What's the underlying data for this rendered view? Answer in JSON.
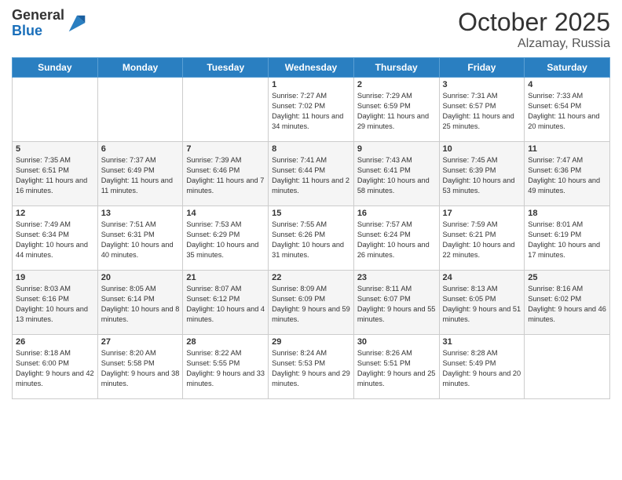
{
  "header": {
    "logo_general": "General",
    "logo_blue": "Blue",
    "month": "October 2025",
    "location": "Alzamay, Russia"
  },
  "days_of_week": [
    "Sunday",
    "Monday",
    "Tuesday",
    "Wednesday",
    "Thursday",
    "Friday",
    "Saturday"
  ],
  "weeks": [
    [
      {
        "day": "",
        "info": ""
      },
      {
        "day": "",
        "info": ""
      },
      {
        "day": "",
        "info": ""
      },
      {
        "day": "1",
        "info": "Sunrise: 7:27 AM\nSunset: 7:02 PM\nDaylight: 11 hours and 34 minutes."
      },
      {
        "day": "2",
        "info": "Sunrise: 7:29 AM\nSunset: 6:59 PM\nDaylight: 11 hours and 29 minutes."
      },
      {
        "day": "3",
        "info": "Sunrise: 7:31 AM\nSunset: 6:57 PM\nDaylight: 11 hours and 25 minutes."
      },
      {
        "day": "4",
        "info": "Sunrise: 7:33 AM\nSunset: 6:54 PM\nDaylight: 11 hours and 20 minutes."
      }
    ],
    [
      {
        "day": "5",
        "info": "Sunrise: 7:35 AM\nSunset: 6:51 PM\nDaylight: 11 hours and 16 minutes."
      },
      {
        "day": "6",
        "info": "Sunrise: 7:37 AM\nSunset: 6:49 PM\nDaylight: 11 hours and 11 minutes."
      },
      {
        "day": "7",
        "info": "Sunrise: 7:39 AM\nSunset: 6:46 PM\nDaylight: 11 hours and 7 minutes."
      },
      {
        "day": "8",
        "info": "Sunrise: 7:41 AM\nSunset: 6:44 PM\nDaylight: 11 hours and 2 minutes."
      },
      {
        "day": "9",
        "info": "Sunrise: 7:43 AM\nSunset: 6:41 PM\nDaylight: 10 hours and 58 minutes."
      },
      {
        "day": "10",
        "info": "Sunrise: 7:45 AM\nSunset: 6:39 PM\nDaylight: 10 hours and 53 minutes."
      },
      {
        "day": "11",
        "info": "Sunrise: 7:47 AM\nSunset: 6:36 PM\nDaylight: 10 hours and 49 minutes."
      }
    ],
    [
      {
        "day": "12",
        "info": "Sunrise: 7:49 AM\nSunset: 6:34 PM\nDaylight: 10 hours and 44 minutes."
      },
      {
        "day": "13",
        "info": "Sunrise: 7:51 AM\nSunset: 6:31 PM\nDaylight: 10 hours and 40 minutes."
      },
      {
        "day": "14",
        "info": "Sunrise: 7:53 AM\nSunset: 6:29 PM\nDaylight: 10 hours and 35 minutes."
      },
      {
        "day": "15",
        "info": "Sunrise: 7:55 AM\nSunset: 6:26 PM\nDaylight: 10 hours and 31 minutes."
      },
      {
        "day": "16",
        "info": "Sunrise: 7:57 AM\nSunset: 6:24 PM\nDaylight: 10 hours and 26 minutes."
      },
      {
        "day": "17",
        "info": "Sunrise: 7:59 AM\nSunset: 6:21 PM\nDaylight: 10 hours and 22 minutes."
      },
      {
        "day": "18",
        "info": "Sunrise: 8:01 AM\nSunset: 6:19 PM\nDaylight: 10 hours and 17 minutes."
      }
    ],
    [
      {
        "day": "19",
        "info": "Sunrise: 8:03 AM\nSunset: 6:16 PM\nDaylight: 10 hours and 13 minutes."
      },
      {
        "day": "20",
        "info": "Sunrise: 8:05 AM\nSunset: 6:14 PM\nDaylight: 10 hours and 8 minutes."
      },
      {
        "day": "21",
        "info": "Sunrise: 8:07 AM\nSunset: 6:12 PM\nDaylight: 10 hours and 4 minutes."
      },
      {
        "day": "22",
        "info": "Sunrise: 8:09 AM\nSunset: 6:09 PM\nDaylight: 9 hours and 59 minutes."
      },
      {
        "day": "23",
        "info": "Sunrise: 8:11 AM\nSunset: 6:07 PM\nDaylight: 9 hours and 55 minutes."
      },
      {
        "day": "24",
        "info": "Sunrise: 8:13 AM\nSunset: 6:05 PM\nDaylight: 9 hours and 51 minutes."
      },
      {
        "day": "25",
        "info": "Sunrise: 8:16 AM\nSunset: 6:02 PM\nDaylight: 9 hours and 46 minutes."
      }
    ],
    [
      {
        "day": "26",
        "info": "Sunrise: 8:18 AM\nSunset: 6:00 PM\nDaylight: 9 hours and 42 minutes."
      },
      {
        "day": "27",
        "info": "Sunrise: 8:20 AM\nSunset: 5:58 PM\nDaylight: 9 hours and 38 minutes."
      },
      {
        "day": "28",
        "info": "Sunrise: 8:22 AM\nSunset: 5:55 PM\nDaylight: 9 hours and 33 minutes."
      },
      {
        "day": "29",
        "info": "Sunrise: 8:24 AM\nSunset: 5:53 PM\nDaylight: 9 hours and 29 minutes."
      },
      {
        "day": "30",
        "info": "Sunrise: 8:26 AM\nSunset: 5:51 PM\nDaylight: 9 hours and 25 minutes."
      },
      {
        "day": "31",
        "info": "Sunrise: 8:28 AM\nSunset: 5:49 PM\nDaylight: 9 hours and 20 minutes."
      },
      {
        "day": "",
        "info": ""
      }
    ]
  ]
}
